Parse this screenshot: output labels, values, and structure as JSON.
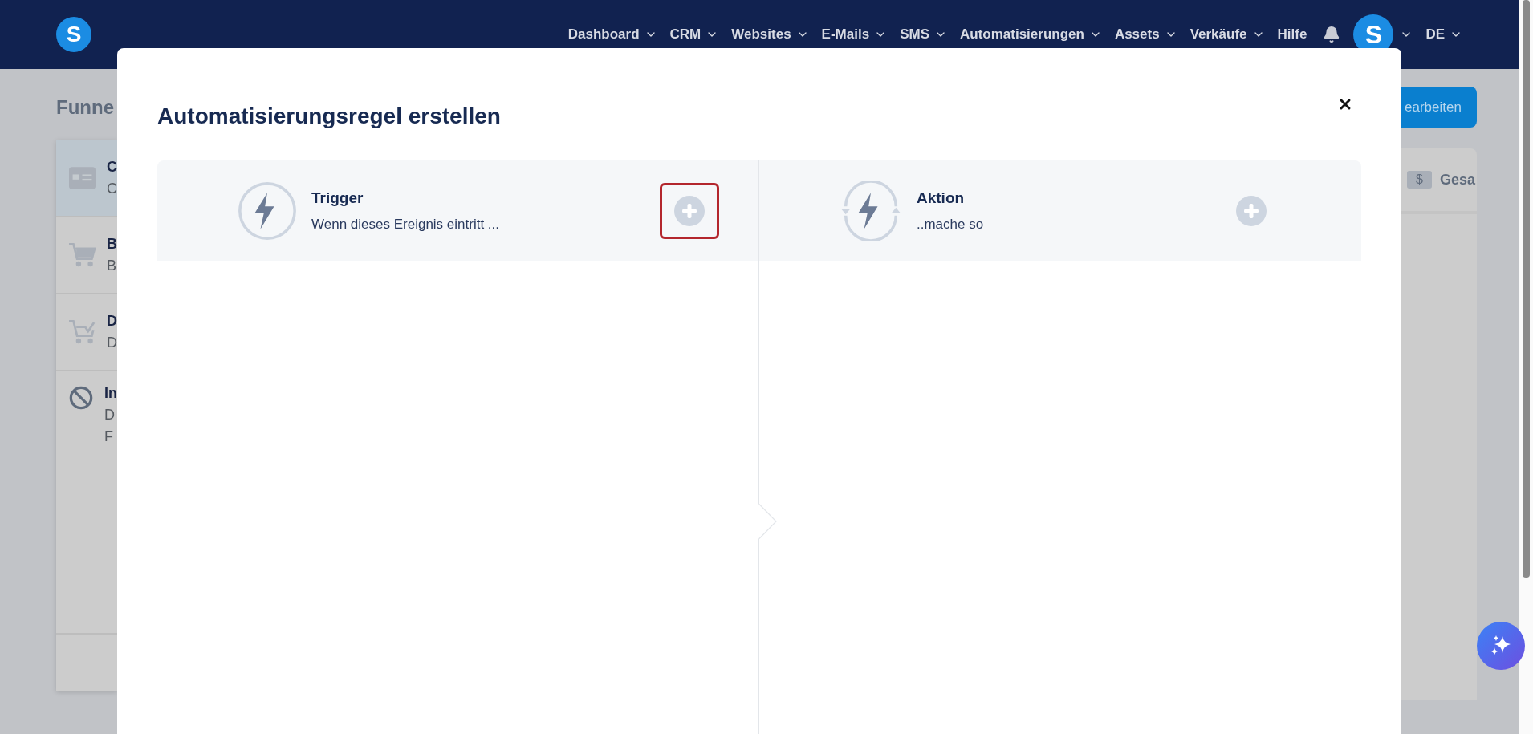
{
  "nav": {
    "logo": "S",
    "items": [
      {
        "label": "Dashboard",
        "dropdown": true
      },
      {
        "label": "CRM",
        "dropdown": true
      },
      {
        "label": "Websites",
        "dropdown": true
      },
      {
        "label": "E-Mails",
        "dropdown": true
      },
      {
        "label": "SMS",
        "dropdown": true
      },
      {
        "label": "Automatisierungen",
        "dropdown": true
      },
      {
        "label": "Assets",
        "dropdown": true
      },
      {
        "label": "Verkäufe",
        "dropdown": true
      },
      {
        "label": "Hilfe",
        "dropdown": false
      }
    ],
    "avatar": "S",
    "language": "DE"
  },
  "page": {
    "title": "Funne",
    "rows": [
      {
        "kind": "card",
        "selected": true,
        "lines": [
          "C",
          "C"
        ]
      },
      {
        "kind": "cart",
        "selected": false,
        "lines": [
          "B",
          "B"
        ]
      },
      {
        "kind": "cart-check",
        "selected": false,
        "lines": [
          "D",
          "D"
        ]
      },
      {
        "kind": "blocked",
        "selected": false,
        "lines": [
          "In",
          "D",
          "F"
        ]
      }
    ],
    "edit_button": "earbeiten",
    "stat": {
      "badge": "$",
      "label": "Gesa"
    }
  },
  "modal": {
    "title": "Automatisierungsregel erstellen",
    "panels": [
      {
        "kind": "trigger",
        "title": "Trigger",
        "subtitle": "Wenn dieses Ereignis eintritt ...",
        "highlighted": true
      },
      {
        "kind": "action",
        "title": "Aktion",
        "subtitle": "..mache so",
        "highlighted": false
      }
    ]
  }
}
